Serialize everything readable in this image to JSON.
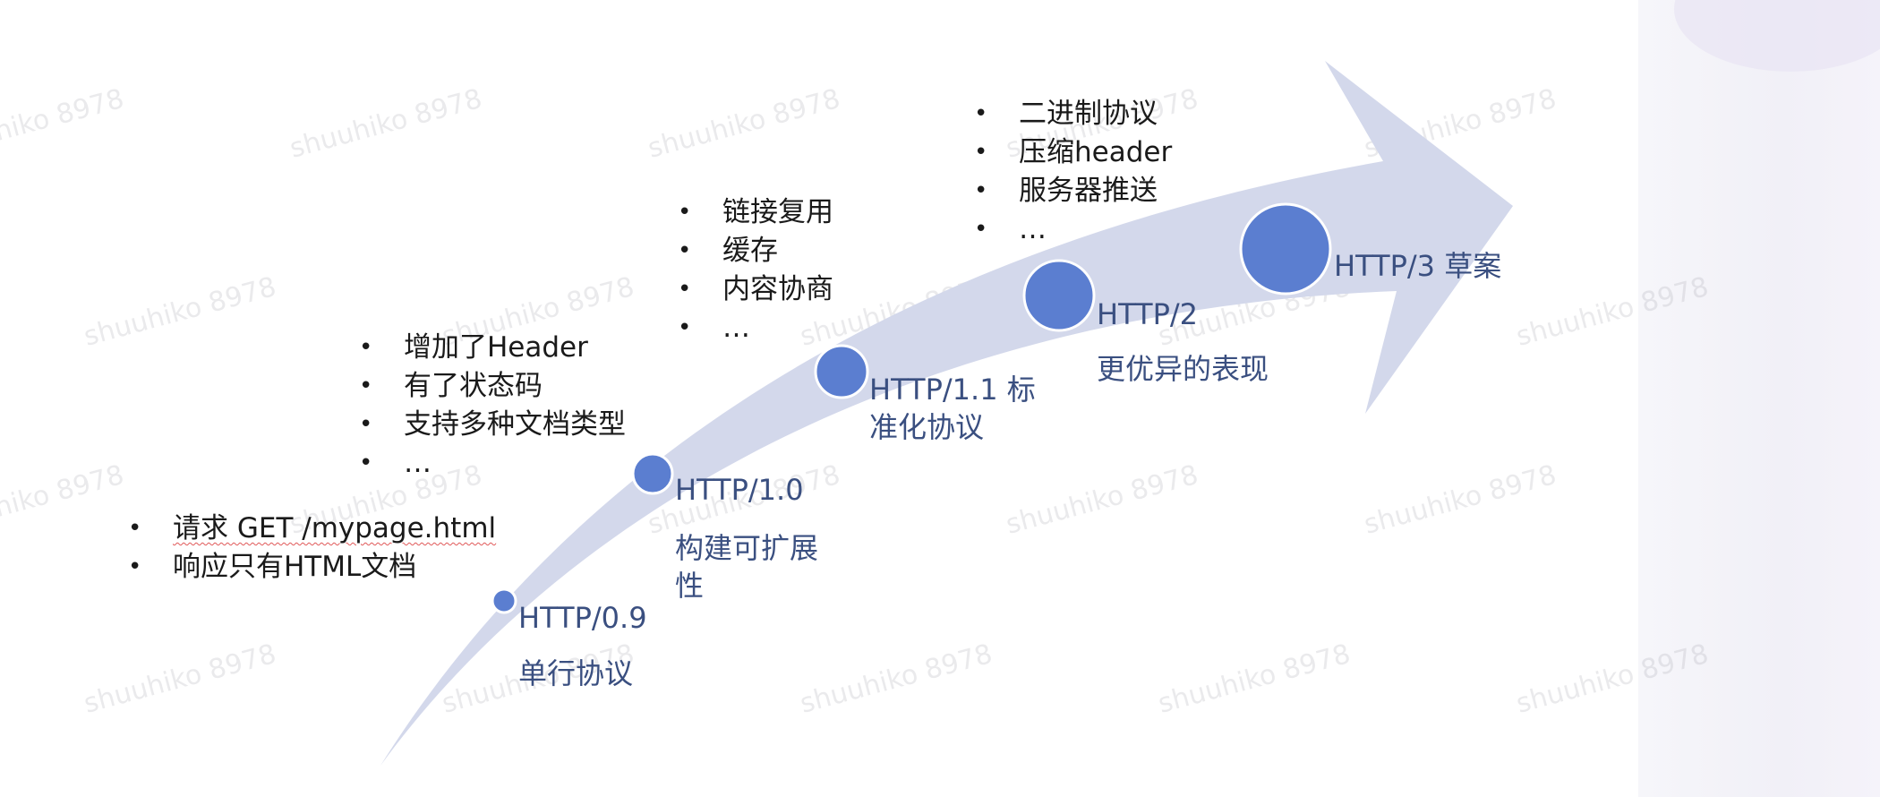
{
  "watermark": "shuuhiko 8978",
  "colors": {
    "arrow": "#d3d8eb",
    "node": "#5b7ed0",
    "label": "#3a4f80",
    "text": "#1a1a1a"
  },
  "stages": [
    {
      "version": "HTTP/0.9",
      "description": "单行协议",
      "features": [
        "请求 GET /mypage.html",
        "响应只有HTML文档"
      ]
    },
    {
      "version": "HTTP/1.0",
      "description": "构建可扩展性",
      "features": [
        "增加了Header",
        "有了状态码",
        "支持多种文档类型",
        "…"
      ]
    },
    {
      "version": "HTTP/1.1 标准化协议",
      "description": "",
      "features": [
        "链接复用",
        "缓存",
        "内容协商",
        "…"
      ]
    },
    {
      "version": "HTTP/2",
      "description": "更优异的表现",
      "features": [
        "二进制协议",
        "压缩header",
        "服务器推送",
        "…"
      ]
    },
    {
      "version": "HTTP/3 草案",
      "description": "",
      "features": []
    }
  ]
}
